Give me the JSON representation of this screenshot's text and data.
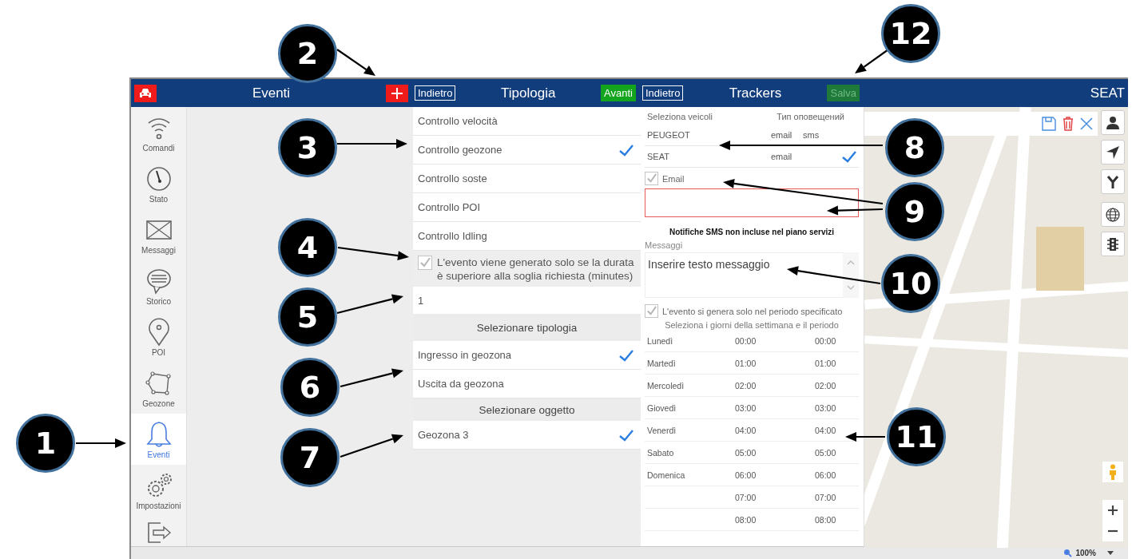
{
  "app_bar": {
    "events_title": "Eventi",
    "type_back": "Indietro",
    "type_title": "Tipologia",
    "type_next": "Avanti",
    "trackers_back": "Indietro",
    "trackers_title": "Trackers",
    "save": "Salva",
    "save_disabled": true,
    "vehicle": "SEAT"
  },
  "sidebar": {
    "items": [
      {
        "kind": "wifi",
        "label": "Comandi",
        "selected": false
      },
      {
        "kind": "gauge",
        "label": "Stato",
        "selected": false
      },
      {
        "kind": "mail",
        "label": "Messaggi",
        "selected": false
      },
      {
        "kind": "chat",
        "label": "Storico",
        "selected": false
      },
      {
        "kind": "pin",
        "label": "POI",
        "selected": false
      },
      {
        "kind": "polygon",
        "label": "Geozone",
        "selected": false
      },
      {
        "kind": "bell",
        "label": "Eventi",
        "selected": true
      },
      {
        "kind": "gears",
        "label": "Impostazioni",
        "selected": false
      },
      {
        "kind": "exit",
        "selected": false
      }
    ]
  },
  "event_types": [
    {
      "label": "Controllo velocità",
      "selected": false
    },
    {
      "label": "Controllo geozone",
      "selected": true
    },
    {
      "label": "Controllo soste",
      "selected": false
    },
    {
      "label": "Controllo POI",
      "selected": false
    },
    {
      "label": "Controllo Idling",
      "selected": false
    }
  ],
  "duration_option": {
    "label": "L'evento viene generato solo se la durata è superiore alla soglia richiesta (minutes)",
    "checked": true
  },
  "duration_value": "1",
  "type_section": {
    "heading": "Selezionare tipologia",
    "options": [
      {
        "label": "Ingresso in geozona",
        "selected": true
      },
      {
        "label": "Uscita da geozona",
        "selected": false
      }
    ]
  },
  "object_section": {
    "heading": "Selezionare oggetto",
    "options": [
      {
        "label": "Geozona 3",
        "selected": true
      }
    ]
  },
  "trackers": {
    "vehicles_heading": "Seleziona veicoli",
    "notify_heading": "Тип оповещений",
    "vehicles": [
      {
        "name": "PEUGEOT",
        "channels": [
          "email",
          "sms"
        ],
        "selected": false
      },
      {
        "name": "SEAT",
        "channels": [
          "email"
        ],
        "selected": true
      }
    ],
    "email_option": {
      "label": "Email",
      "checked": true
    },
    "email_field": {
      "invalid": true
    },
    "sms_notice": "Notifiche SMS non incluse nel piano servizi",
    "message_label": "Messaggi",
    "message_placeholder": "Inserire testo messaggio",
    "period_option": {
      "label": "L'evento si genera solo nel periodo specificato",
      "checked": true
    },
    "period_hint": "Seleziona i giorni della settimana e il periodo",
    "schedule": [
      {
        "day": "Lunedì",
        "from": "00:00",
        "to": "00:00"
      },
      {
        "day": "Martedì",
        "from": "01:00",
        "to": "01:00"
      },
      {
        "day": "Mercoledì",
        "from": "02:00",
        "to": "02:00"
      },
      {
        "day": "Giovedì",
        "from": "03:00",
        "to": "03:00"
      },
      {
        "day": "Venerdì",
        "from": "04:00",
        "to": "04:00"
      },
      {
        "day": "Sabato",
        "from": "05:00",
        "to": "05:00"
      },
      {
        "day": "Domenica",
        "from": "06:00",
        "to": "06:00"
      },
      {
        "from": "07:00",
        "to": "07:00"
      },
      {
        "from": "08:00",
        "to": "08:00"
      }
    ]
  },
  "map": {
    "zoom": "100%"
  },
  "callouts": [
    {
      "number": "12"
    },
    {
      "number": "2"
    },
    {
      "number": "3"
    },
    {
      "number": "8"
    },
    {
      "number": "9"
    },
    {
      "number": "4"
    },
    {
      "number": "10"
    },
    {
      "number": "5"
    },
    {
      "number": "6"
    },
    {
      "number": "11"
    },
    {
      "number": "1"
    },
    {
      "number": "7"
    }
  ]
}
